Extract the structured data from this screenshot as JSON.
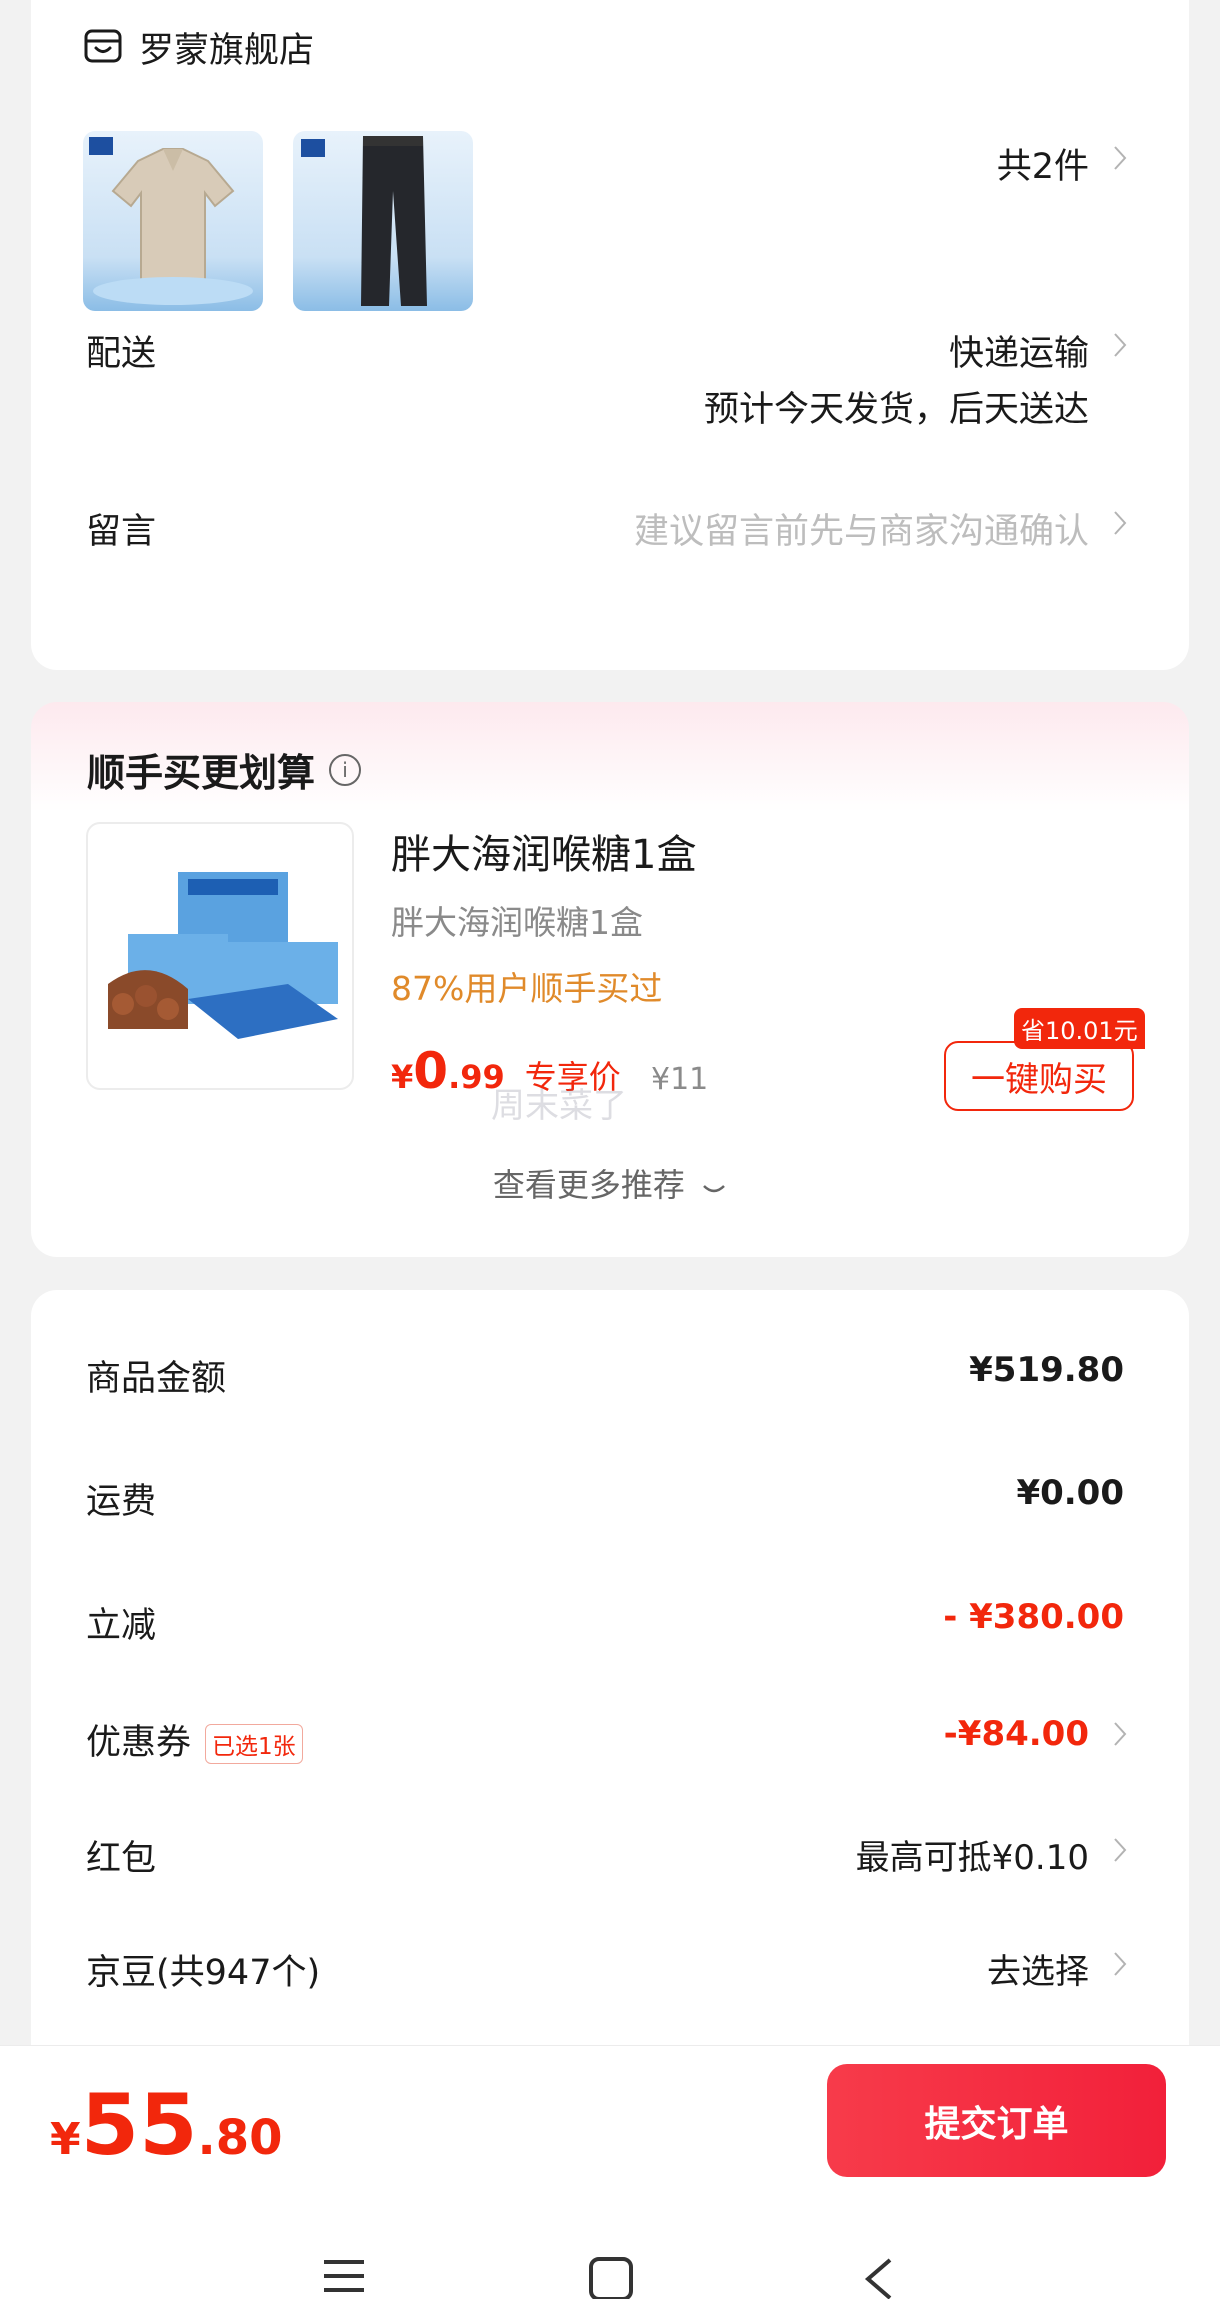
{
  "colors": {
    "accent": "#f2270c",
    "submit": "#f52c42",
    "orange_tag": "#e08a2a"
  },
  "shop": {
    "icon": "store-icon",
    "name": "罗蒙旗舰店",
    "item_count": "共2件",
    "items": [
      {
        "name": "polo-shirt-thumbnail"
      },
      {
        "name": "pants-thumbnail"
      }
    ]
  },
  "delivery": {
    "label": "配送",
    "method": "快递运输",
    "estimate": "预计今天发货，后天送达"
  },
  "message": {
    "label": "留言",
    "placeholder": "建议留言前先与商家沟通确认"
  },
  "upsell": {
    "title": "顺手买更划算",
    "info_icon": "info-icon",
    "product": {
      "title": "胖大海润喉糖1盒",
      "subtitle": "胖大海润喉糖1盒",
      "tag": "87%用户顺手买过",
      "price_currency": "¥",
      "price_int": "0",
      "price_dec": ".99",
      "price_label": "专享价",
      "original_price": "¥11",
      "save_badge": "省10.01元",
      "buy_button": "一键购买"
    },
    "more": "查看更多推荐"
  },
  "watermark": "周末菜了",
  "summary": {
    "goods_amount": {
      "label": "商品金额",
      "value": "¥519.80"
    },
    "shipping": {
      "label": "运费",
      "value": "¥0.00"
    },
    "discount": {
      "label": "立减",
      "value": "- ¥380.00"
    },
    "coupon": {
      "label": "优惠券",
      "tag": "已选1张",
      "value": "-¥84.00"
    },
    "red_packet": {
      "label": "红包",
      "value": "最高可抵¥0.10"
    },
    "jd_beans": {
      "label": "京豆(共947个)",
      "value": "去选择"
    }
  },
  "bottom": {
    "currency": "¥",
    "total_int": "55",
    "total_dec": ".80",
    "submit_label": "提交订单"
  },
  "system_nav": [
    "menu-icon",
    "home-icon",
    "back-icon"
  ]
}
